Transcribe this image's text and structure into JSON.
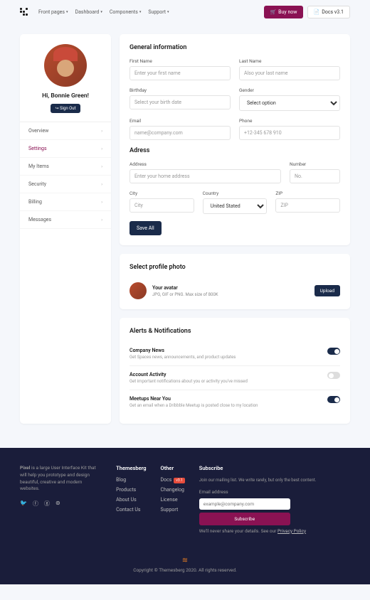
{
  "nav": {
    "items": [
      "Front pages",
      "Dashboard",
      "Components",
      "Support"
    ],
    "buy": "Buy now",
    "docs": "Docs v3.1"
  },
  "sidebar": {
    "greeting": "Hi, Bonnie Green!",
    "signout": "Sign Out",
    "menu": [
      "Overview",
      "Settings",
      "My Items",
      "Security",
      "Billing",
      "Messages"
    ],
    "active": 1
  },
  "general": {
    "title": "General information",
    "fields": {
      "firstName": {
        "label": "First Name",
        "placeholder": "Enter your first name"
      },
      "lastName": {
        "label": "Last Name",
        "placeholder": "Also your last name"
      },
      "birthday": {
        "label": "Birthday",
        "placeholder": "Select your birth date"
      },
      "gender": {
        "label": "Gender",
        "placeholder": "Select option"
      },
      "email": {
        "label": "Email",
        "placeholder": "name@company.com"
      },
      "phone": {
        "label": "Phone",
        "placeholder": "+12-345 678 910"
      }
    }
  },
  "address": {
    "title": "Adress",
    "fields": {
      "address": {
        "label": "Address",
        "placeholder": "Enter your home address"
      },
      "number": {
        "label": "Number",
        "placeholder": "No."
      },
      "city": {
        "label": "City",
        "placeholder": "City"
      },
      "country": {
        "label": "Country",
        "value": "United Stated"
      },
      "zip": {
        "label": "ZIP",
        "placeholder": "ZIP"
      }
    },
    "save": "Save All"
  },
  "photo": {
    "title": "Select profile photo",
    "heading": "Your avatar",
    "hint": "JPG, GIF or PNG. Max size of 800K",
    "upload": "Upload"
  },
  "alerts": {
    "title": "Alerts & Notifications",
    "items": [
      {
        "title": "Company News",
        "desc": "Get Spaces news, announcements, and product updates",
        "on": true
      },
      {
        "title": "Account Activity",
        "desc": "Get important notifications about you or activity you've missed",
        "on": false
      },
      {
        "title": "Meetups Near You",
        "desc": "Get an email when a Dribbble Meetup is posted close to my location",
        "on": true
      }
    ]
  },
  "footer": {
    "about": {
      "brand": "Pixel",
      "text": " is a large User Interface Kit that will help you prototype and design beautiful, creative and modern websites."
    },
    "cols": {
      "themesberg": {
        "title": "Themesberg",
        "links": [
          "Blog",
          "Products",
          "About Us",
          "Contact Us"
        ]
      },
      "other": {
        "title": "Other",
        "links": [
          {
            "t": "Docs",
            "badge": "v3.1"
          },
          {
            "t": "Changelog"
          },
          {
            "t": "License"
          },
          {
            "t": "Support"
          }
        ]
      }
    },
    "subscribe": {
      "title": "Subscribe",
      "desc": "Join our mailing list. We write rarely, but only the best content.",
      "emailLabel": "Email address",
      "placeholder": "example@company.com",
      "button": "Subscribe",
      "note": "We'll never share your details. See our ",
      "policy": "Privacy Policy"
    },
    "copyright": "Copyright © Themesberg 2020. All rights reserved."
  }
}
